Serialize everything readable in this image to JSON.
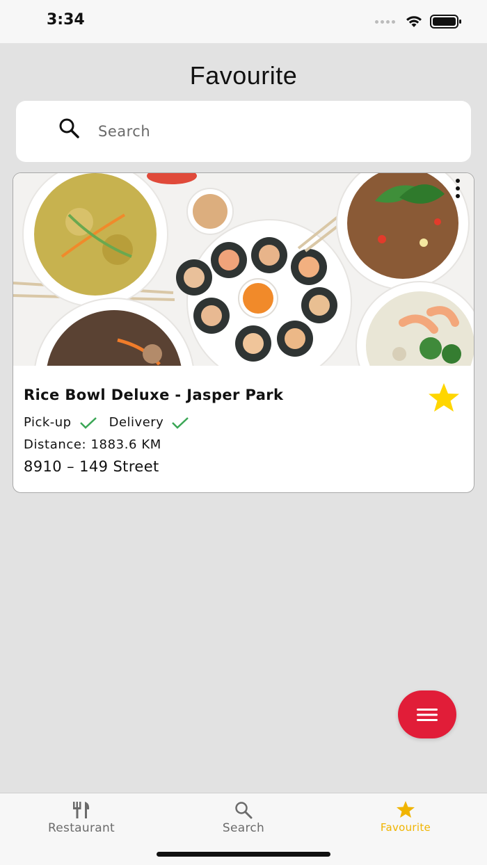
{
  "status_bar": {
    "time": "3:34"
  },
  "page": {
    "title": "Favourite"
  },
  "search": {
    "placeholder": "Search"
  },
  "favourites": [
    {
      "name": "Rice Bowl Deluxe - Jasper Park",
      "services": [
        "Pick-up",
        "Delivery"
      ],
      "distance": "Distance: 1883.6 KM",
      "address": "8910 – 149 Street",
      "favourited": true
    }
  ],
  "tab_bar": {
    "tabs": [
      {
        "label": "Restaurant",
        "icon": "fork-knife-icon",
        "active": false
      },
      {
        "label": "Search",
        "icon": "search-icon",
        "active": false
      },
      {
        "label": "Favourite",
        "icon": "star-icon",
        "active": true
      }
    ]
  },
  "colors": {
    "accent_red": "#e11d38",
    "active_tab": "#f0b400",
    "star": "#ffd600",
    "check_green": "#3aa655"
  }
}
